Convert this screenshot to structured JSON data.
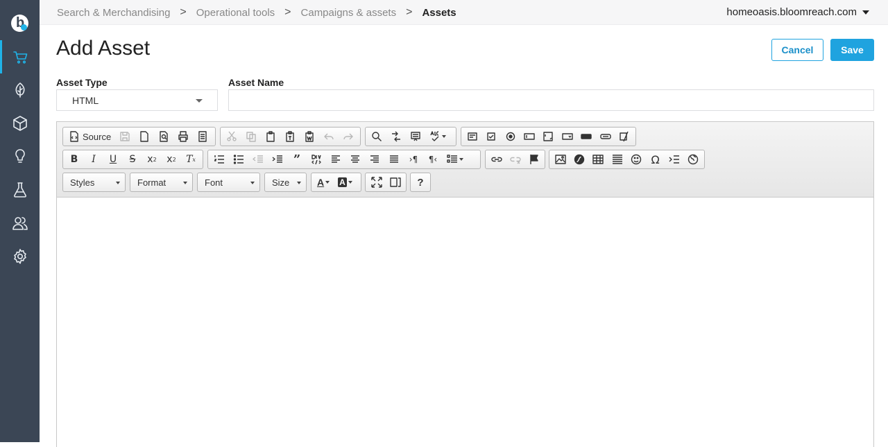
{
  "sidebar": {
    "logo": "b",
    "items": [
      {
        "name": "cart-icon",
        "active": true
      },
      {
        "name": "leaf-icon",
        "active": false
      },
      {
        "name": "box-icon",
        "active": false
      },
      {
        "name": "lightbulb-icon",
        "active": false
      },
      {
        "name": "flask-icon",
        "active": false
      },
      {
        "name": "users-icon",
        "active": false
      },
      {
        "name": "gear-icon",
        "active": false
      }
    ]
  },
  "breadcrumb": {
    "items": [
      "Search & Merchandising",
      "Operational tools",
      "Campaigns & assets"
    ],
    "current": "Assets",
    "separator": ">"
  },
  "account": {
    "domain": "homeoasis.bloomreach.com"
  },
  "page": {
    "title": "Add Asset",
    "cancel_label": "Cancel",
    "save_label": "Save"
  },
  "form": {
    "asset_type_label": "Asset Type",
    "asset_type_value": "HTML",
    "asset_name_label": "Asset Name",
    "asset_name_value": ""
  },
  "editor": {
    "source_label": "Source",
    "combos": {
      "styles": "Styles",
      "format": "Format",
      "font": "Font",
      "size": "Size"
    },
    "help_label": "?"
  },
  "colors": {
    "sidebar_bg": "#3b4655",
    "accent": "#1fa3df"
  }
}
